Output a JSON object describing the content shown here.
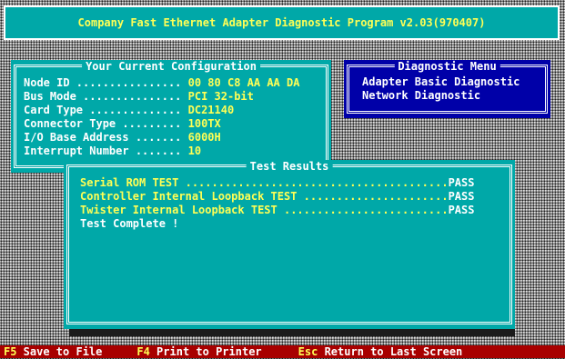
{
  "window": {
    "title": "Company Fast Ethernet Adapter Diagnostic Program v2.03(970407)"
  },
  "config": {
    "heading": "Your Current Configuration",
    "rows": [
      {
        "label": "Node ID ................ ",
        "value": "00 80 C8 AA AA DA"
      },
      {
        "label": "Bus Mode ............... ",
        "value": "PCI 32-bit"
      },
      {
        "label": "Card Type .............. ",
        "value": "DC21140"
      },
      {
        "label": "Connector Type ......... ",
        "value": "100TX"
      },
      {
        "label": "I/O Base Address ....... ",
        "value": "6000H"
      },
      {
        "label": "Interrupt Number ....... ",
        "value": "10"
      }
    ]
  },
  "diagnostic_menu": {
    "heading": "Diagnostic Menu",
    "items": [
      {
        "label": "Adapter Basic Diagnostic"
      },
      {
        "label": "Network Diagnostic"
      }
    ]
  },
  "results": {
    "heading": "Test Results",
    "tests": [
      {
        "name": "Serial ROM TEST ........................................",
        "result": "PASS"
      },
      {
        "name": "Controller Internal Loopback TEST ......................",
        "result": "PASS"
      },
      {
        "name": "Twister Internal Loopback TEST .........................",
        "result": "PASS"
      }
    ],
    "complete": "Test Complete !"
  },
  "function_bar": [
    {
      "key": "F5",
      "label": " Save to File"
    },
    {
      "key": "F4",
      "label": " Print to Printer"
    },
    {
      "key": "Esc",
      "label": " Return to Last Screen"
    }
  ]
}
